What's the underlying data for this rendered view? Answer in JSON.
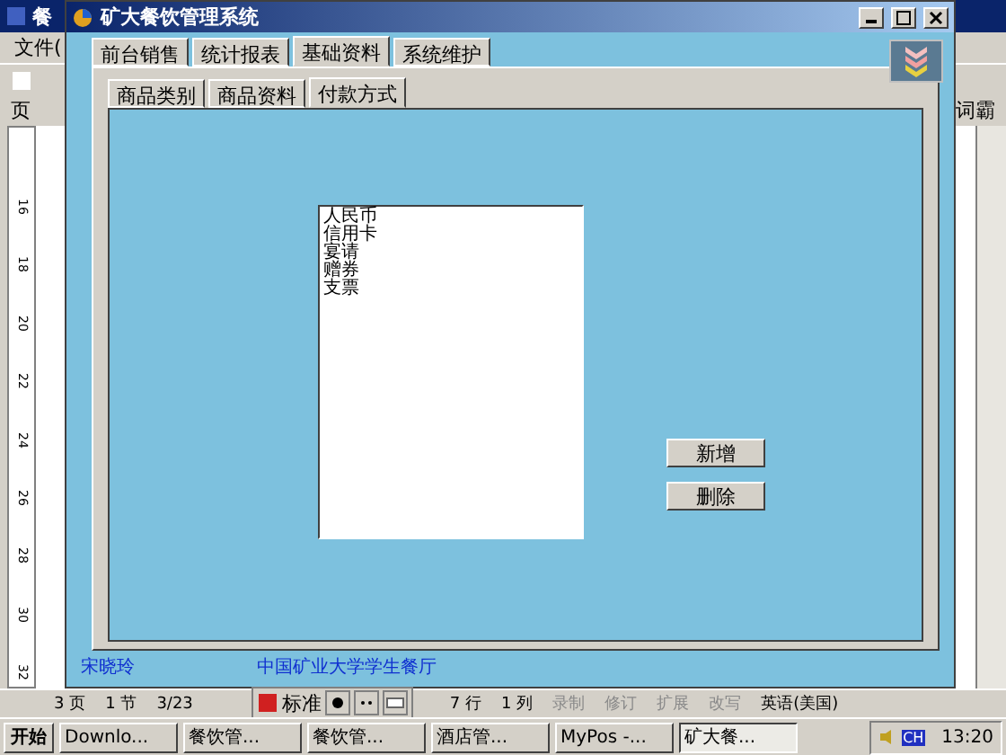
{
  "word_window": {
    "title": "餐",
    "menu": [
      "文件("
    ],
    "toolbar_label": "页",
    "right_toolbar_text": "词霸",
    "ruler_labels": [
      "16",
      "18",
      "20",
      "22",
      "24",
      "26",
      "28",
      "30",
      "32"
    ],
    "status_bar": [
      {
        "text": "3 页",
        "disabled": false
      },
      {
        "text": "1 节",
        "disabled": false
      },
      {
        "text": "3/23",
        "disabled": false
      },
      {
        "text": "7 行",
        "disabled": false
      },
      {
        "text": "1 列",
        "disabled": false
      },
      {
        "text": "录制",
        "disabled": true
      },
      {
        "text": "修订",
        "disabled": true
      },
      {
        "text": "扩展",
        "disabled": true
      },
      {
        "text": "改写",
        "disabled": true
      },
      {
        "text": "英语(美国)",
        "disabled": false
      }
    ]
  },
  "app_window": {
    "title": "矿大餐饮管理系统",
    "tabs": [
      {
        "label": "前台销售",
        "selected": false
      },
      {
        "label": "统计报表",
        "selected": false
      },
      {
        "label": "基础资料",
        "selected": true
      },
      {
        "label": "系统维护",
        "selected": false
      }
    ],
    "subtabs": [
      {
        "label": "商品类别",
        "selected": false
      },
      {
        "label": "商品资料",
        "selected": false
      },
      {
        "label": "付款方式",
        "selected": true
      }
    ],
    "payment_methods": [
      "人民币",
      "信用卡",
      "宴请",
      "赠券",
      "支票"
    ],
    "buttons": [
      "新增",
      "删除"
    ],
    "footer": [
      "宋晓玲",
      "中国矿业大学学生餐厅"
    ]
  },
  "ime_bar": {
    "mode": "标准"
  },
  "taskbar": {
    "start": "开始",
    "tasks": [
      {
        "label": "Downlo...",
        "selected": false
      },
      {
        "label": "餐饮管...",
        "selected": false
      },
      {
        "label": "餐饮管...",
        "selected": false
      },
      {
        "label": "酒店管...",
        "selected": false
      },
      {
        "label": "MyPos -...",
        "selected": false
      },
      {
        "label": "矿大餐...",
        "selected": true
      }
    ],
    "language": "CH",
    "clock": "13:20"
  }
}
